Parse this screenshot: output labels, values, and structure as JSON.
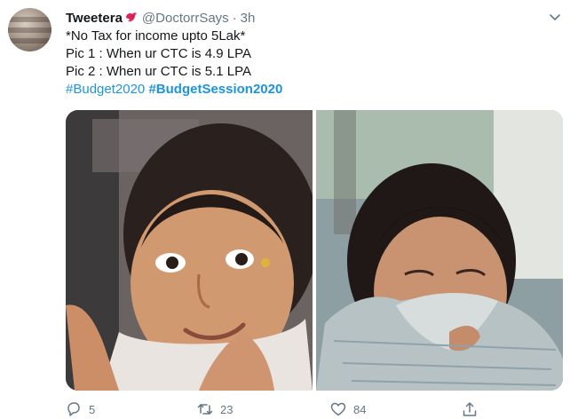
{
  "tweet": {
    "author_name": "Tweetera",
    "handle": "@DoctorrSays",
    "separator": "·",
    "time": "3h",
    "lines": [
      "*No Tax for income upto 5Lak*",
      "Pic 1 : When ur CTC is 4.9 LPA",
      "Pic 2 : When ur CTC is 5.1 LPA"
    ],
    "hashtags": [
      "#Budget2020",
      "#BudgetSession2020"
    ],
    "replies": "5",
    "retweets": "23",
    "likes": "84"
  },
  "colors": {
    "link": "#1b95e0",
    "muted": "#657786",
    "badge": "#e0245e"
  },
  "icons": {
    "badge": "bird-badge-icon",
    "caret": "chevron-down-icon",
    "reply": "reply-icon",
    "retweet": "retweet-icon",
    "like": "heart-icon",
    "share": "share-icon"
  }
}
